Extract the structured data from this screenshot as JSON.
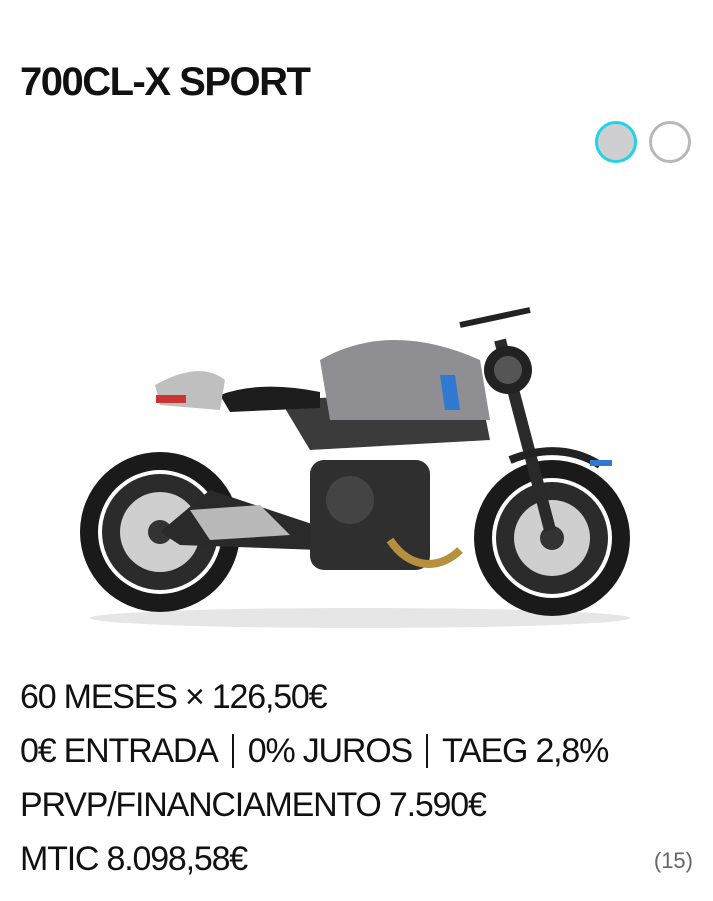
{
  "product": {
    "title": "700CL-X SPORT",
    "image_alt": "motorcycle-image"
  },
  "colors": [
    {
      "name": "silver",
      "hex": "#cfcfd1",
      "selected": true
    },
    {
      "name": "white",
      "hex": "#ffffff",
      "selected": false
    }
  ],
  "accent_color": "#22d3e6",
  "financing": {
    "line1": "60 MESES × 126,50€",
    "entrada": "0€ ENTRADA",
    "juros": "0% JUROS",
    "taeg": "TAEG 2,8%",
    "line3": "PRVP/FINANCIAMENTO 7.590€",
    "line4": "MTIC 8.098,58€",
    "footnote": "(15)"
  }
}
